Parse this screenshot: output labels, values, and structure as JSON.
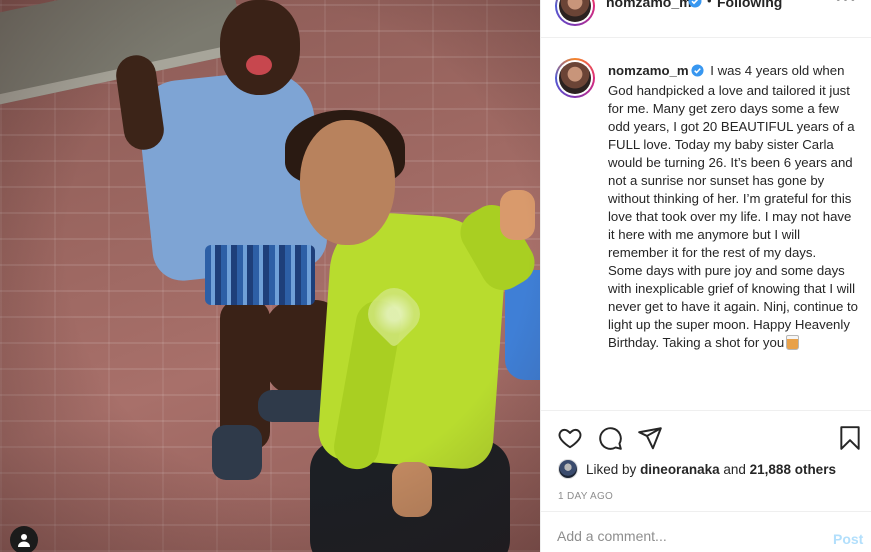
{
  "post": {
    "username": "nomzamo_m",
    "separator": "•",
    "follow_status": "Following",
    "more_label": "•••",
    "caption": {
      "username": "nomzamo_m",
      "paragraph1": "I was 4 years old when God handpicked a love and tailored it just for me. Many get zero days some a few odd years, I got 20 BEAUTIFUL years of a FULL love. Today my baby sister Carla would be turning 26. It’s been 6 years and not a sunrise nor sunset has gone by without thinking of her. I’m grateful for this love that took over my life. I may not have it here with me anymore but I will remember it for the rest of my days.",
      "paragraph2": "Some days with pure joy and some days with inexplicable grief of knowing that I will never get to have it again. Ninj, continue to light up the super moon. Happy Heavenly Birthday. Taking a shot for you",
      "emoji": "tumbler-glass-emoji"
    },
    "likes": {
      "prefix": "Liked by",
      "user": "dineoranaka",
      "joiner": "and",
      "others": "21,888 others"
    },
    "timestamp": "1 DAY AGO",
    "comment": {
      "placeholder": "Add a comment...",
      "post_label": "Post"
    }
  },
  "icons": [
    "heart-icon",
    "comment-icon",
    "share-icon",
    "bookmark-icon",
    "verified-icon",
    "user-icon"
  ],
  "colors": {
    "verified": "#3897f0",
    "post_button_disabled": "#b2dffc",
    "muted": "#8e8e8e",
    "border": "#efefef"
  }
}
